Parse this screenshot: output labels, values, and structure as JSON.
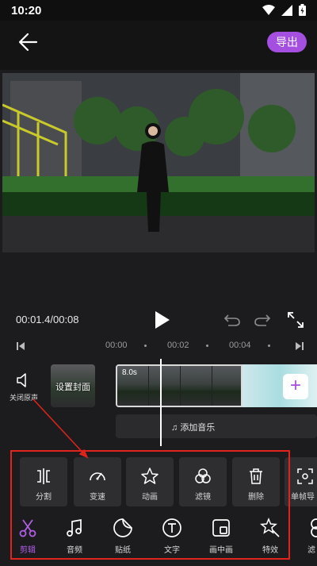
{
  "status": {
    "time": "10:20",
    "icons": [
      "wifi-icon",
      "signal-icon",
      "battery-icon"
    ]
  },
  "header": {
    "export_label": "导出",
    "back_icon": "arrow-left-icon"
  },
  "playback": {
    "timecode": "00:01.4/00:08"
  },
  "ruler": {
    "marks": [
      "00:00",
      "00:02",
      "00:04"
    ]
  },
  "timeline": {
    "mute_label": "关闭原声",
    "cover_label": "设置封面",
    "clip_duration": "8.0s",
    "add_music_label": "添加音乐"
  },
  "tools": [
    {
      "label": "分割",
      "icon": "split-icon"
    },
    {
      "label": "变速",
      "icon": "speedometer-icon"
    },
    {
      "label": "动画",
      "icon": "star-sparkle-icon"
    },
    {
      "label": "滤镜",
      "icon": "filter-circles-icon"
    },
    {
      "label": "删除",
      "icon": "trash-icon"
    },
    {
      "label": "单帧导",
      "icon": "frame-export-icon"
    }
  ],
  "tabs": [
    {
      "label": "剪辑",
      "icon": "scissors-icon",
      "active": true
    },
    {
      "label": "音频",
      "icon": "music-note-icon"
    },
    {
      "label": "贴纸",
      "icon": "sticker-icon"
    },
    {
      "label": "文字",
      "icon": "text-t-icon"
    },
    {
      "label": "画中画",
      "icon": "picture-in-picture-icon"
    },
    {
      "label": "特效",
      "icon": "magic-wand-icon"
    },
    {
      "label": "滤",
      "icon": "filter-icon"
    }
  ],
  "colors": {
    "accent": "#a54fe0",
    "annotation": "#e0231d",
    "background": "#1c1c1e"
  }
}
